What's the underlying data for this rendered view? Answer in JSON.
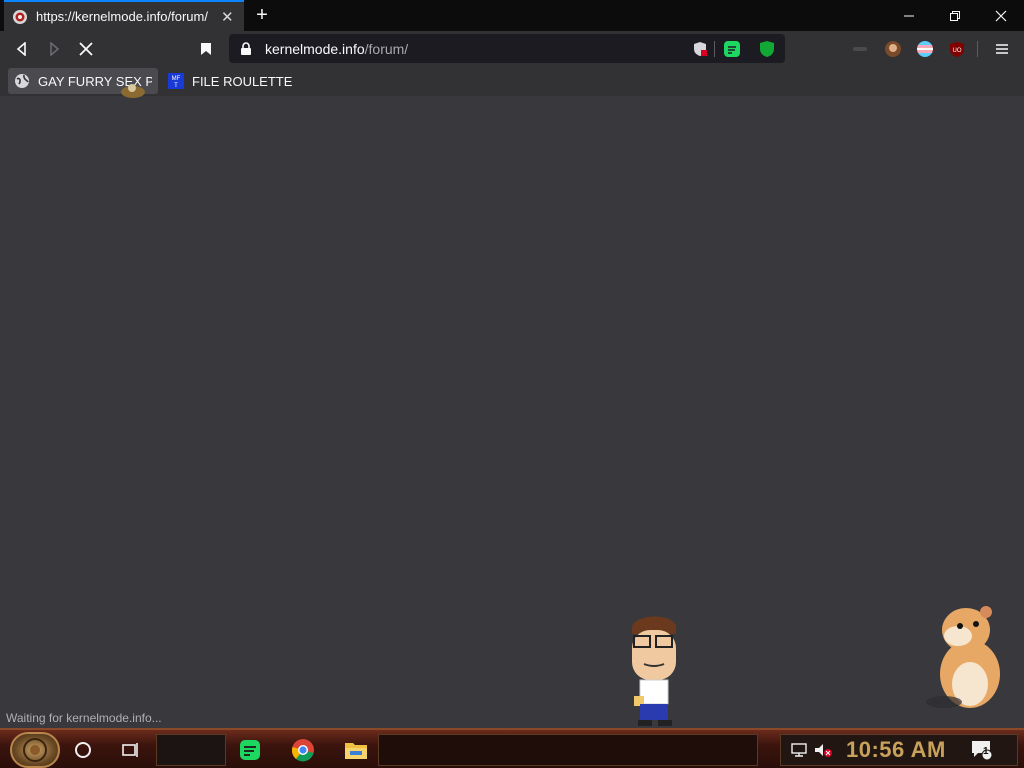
{
  "browser": {
    "tab": {
      "title": "https://kernelmode.info/forum/",
      "favicon": "site-icon",
      "loading": true
    },
    "window_controls": [
      "minimize-icon",
      "restore-icon",
      "close-icon"
    ],
    "url": {
      "host": "kernelmode.info",
      "path": "/forum/"
    },
    "bookmarks": [
      {
        "label": "GAY FURRY SEX P...",
        "icon": "globe-icon"
      },
      {
        "label": "FILE ROULETTE",
        "icon": "mft-icon",
        "icon_text": "MF\nT"
      }
    ],
    "status": "Waiting for kernelmode.info..."
  },
  "taskbar": {
    "clock": "10:56 AM",
    "notification_count": "1",
    "pinned": [
      "cortana-icon",
      "task-view-icon",
      "spotify-icon",
      "chrome-icon",
      "file-explorer-icon"
    ]
  },
  "colors": {
    "accent": "#0a84ff",
    "clock": "#c8a25b",
    "page_bg": "#38383d",
    "spotify": "#1ed760"
  }
}
